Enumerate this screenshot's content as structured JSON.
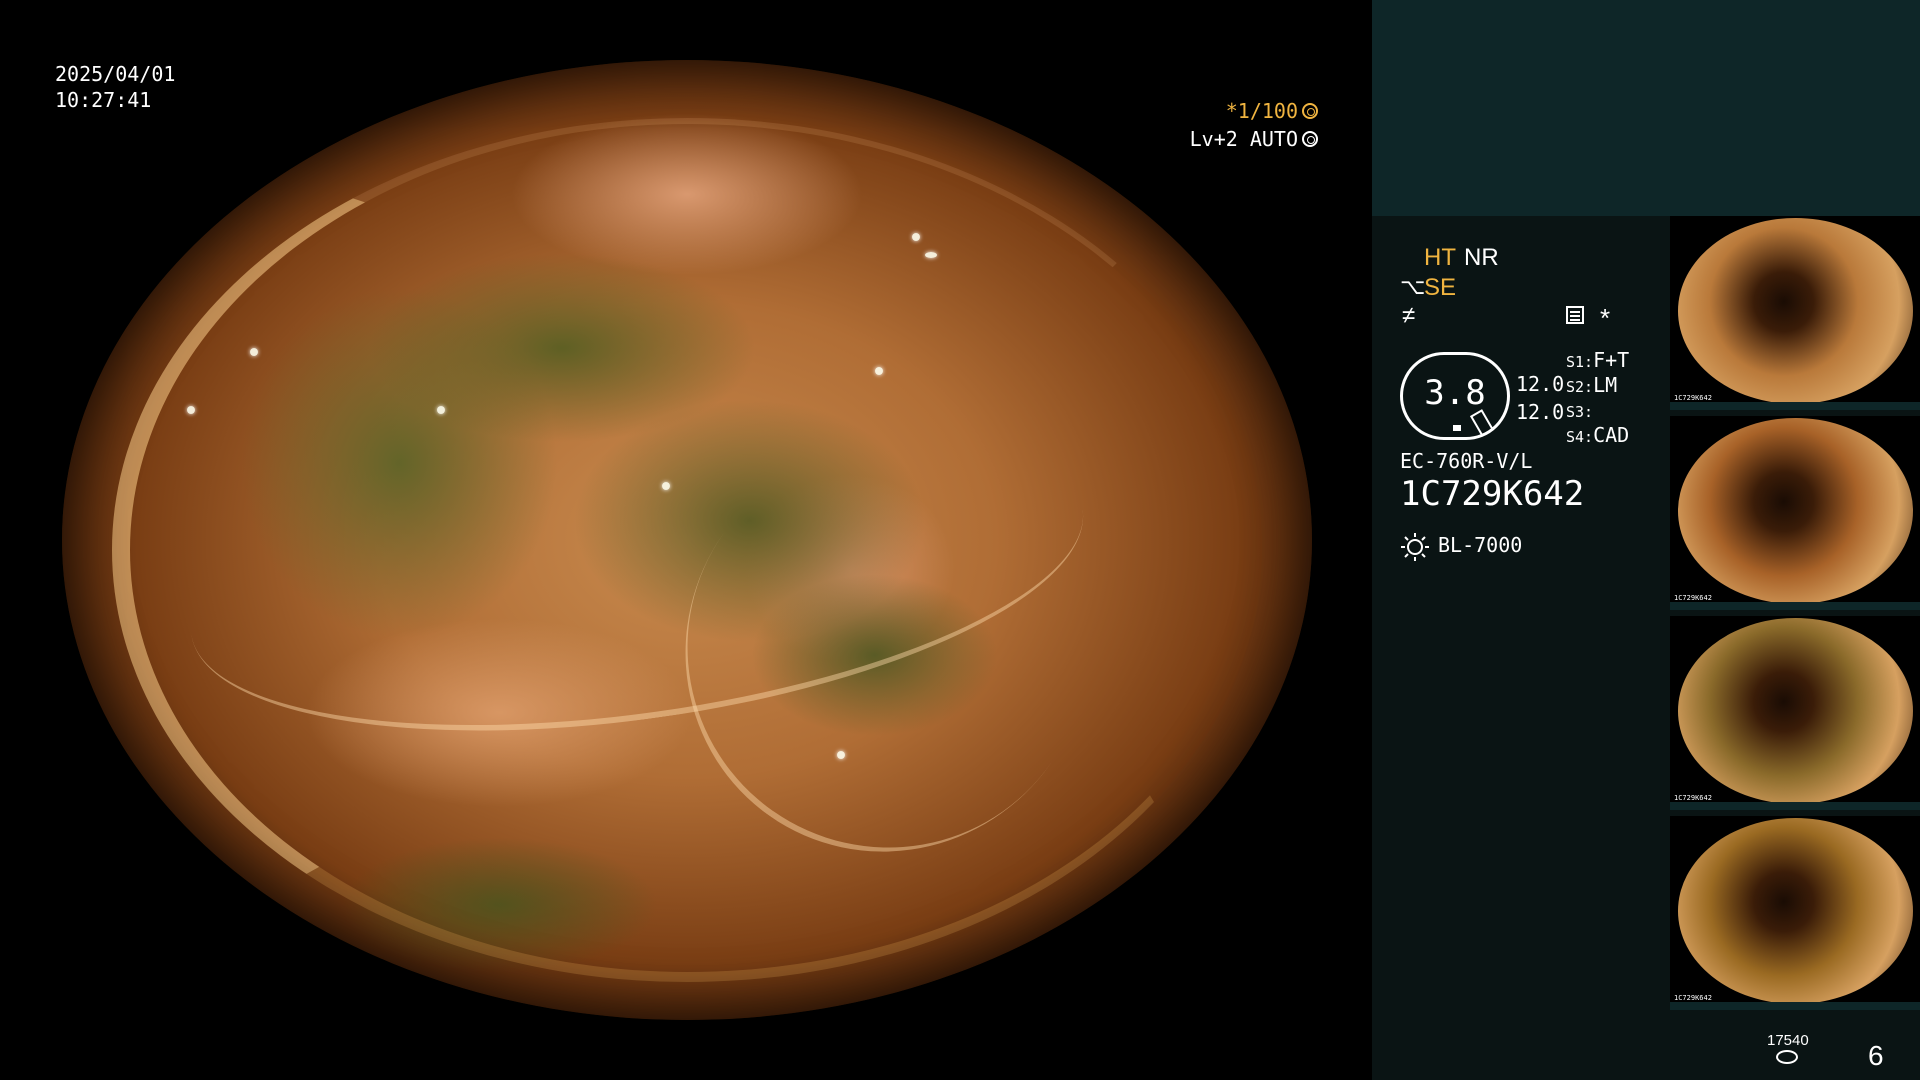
{
  "overlay": {
    "date": "2025/04/01",
    "time": "10:27:41",
    "shutter": "*1/100",
    "shutter_icon": "aperture-icon",
    "level": "Lv+2 AUTO",
    "level_icon": "iris-icon"
  },
  "panel": {
    "ht": "HT",
    "nr": "NR",
    "se": "SE",
    "f_symbol": "≠",
    "asterisk": "*",
    "gauge_value": "3.8",
    "value_a": "12.0",
    "value_b": "12.0",
    "s_rows": [
      {
        "key": "S1:",
        "val": "F+T"
      },
      {
        "key": "S2:",
        "val": "LM"
      },
      {
        "key": "S3:",
        "val": ""
      },
      {
        "key": "S4:",
        "val": "CAD"
      }
    ],
    "scope_model": "EC-760R-V/L",
    "scope_serial": "1C729K642",
    "light_source": "BL-7000"
  },
  "thumbnails": [
    {
      "serial": "1C729K642",
      "tone": "#b9793a"
    },
    {
      "serial": "1C729K642",
      "tone": "#a86228"
    },
    {
      "serial": "1C729K642",
      "tone": "#8a6a2a"
    },
    {
      "serial": "1C729K642",
      "tone": "#9a6a22"
    }
  ],
  "footer": {
    "storage_count": "17540",
    "image_count": "6"
  }
}
